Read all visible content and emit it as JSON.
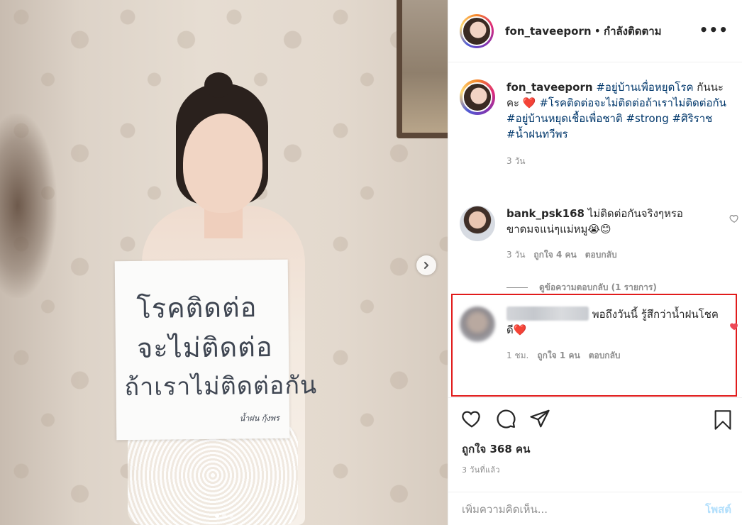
{
  "photo": {
    "sign_lines": [
      "โรคติดต่อ",
      "จะไม่ติดต่อ",
      "ถ้าเราไม่ติดต่อกัน"
    ],
    "sign_signature": "น้ำฝน กุ้งพร",
    "carousel": {
      "count": 3,
      "active_index": 0
    },
    "icons": {
      "next": "chevron-right-icon"
    }
  },
  "header": {
    "username": "fon_taveeporn",
    "separator": "•",
    "follow_status": "กำลังติดตาม",
    "more": "•••"
  },
  "caption": {
    "username": "fon_taveeporn",
    "segments": [
      {
        "text": "#อยู่บ้านเพื่อหยุดโรค",
        "tag": true
      },
      {
        "text": " กันนะคะ ",
        "tag": false
      },
      {
        "text": "❤️",
        "tag": false
      },
      {
        "text": "#โรคติดต่อจะไม่ติดต่อถ้าเราไม่ติดต่อกัน",
        "tag": true
      },
      {
        "text": "#อยู่บ้านหยุดเชื้อเพื่อชาติ",
        "tag": true
      },
      {
        "text": "#strong",
        "tag": true
      },
      {
        "text": "#ศิริราช",
        "tag": true
      },
      {
        "text": "#น้ำฝนทวีพร",
        "tag": true
      }
    ],
    "time": "3 วัน"
  },
  "comments": [
    {
      "username": "bank_psk168",
      "text": "ไม่ติดต่อกันจริงๆหรอ ขาดมจแน่ๆแม่หมู😭😊",
      "time": "3 วัน",
      "likes": "ถูกใจ 4 คน",
      "reply": "ตอบกลับ",
      "liked": false
    },
    {
      "username": "",
      "text": "พอถึงวันนี้ รู้สึกว่าน้ำฝนโชคดี❤️",
      "time": "1 ชม.",
      "likes": "ถูกใจ 1 คน",
      "reply": "ตอบกลับ",
      "liked": true,
      "highlighted": true
    }
  ],
  "view_replies": "ดูข้อความตอบกลับ (1 รายการ)",
  "actions": {
    "likes": "ถูกใจ 368 คน",
    "posted": "3 วันที่แล้ว",
    "add_comment_placeholder": "เพิ่มความคิดเห็น...",
    "post_button": "โพสต์",
    "icons": [
      "heart-icon",
      "comment-icon",
      "share-icon",
      "bookmark-icon"
    ]
  },
  "colors": {
    "hashtag": "#00376b",
    "like_red": "#ed4956",
    "highlight_border": "#e11b1b",
    "post_disabled": "#b2dffc"
  }
}
